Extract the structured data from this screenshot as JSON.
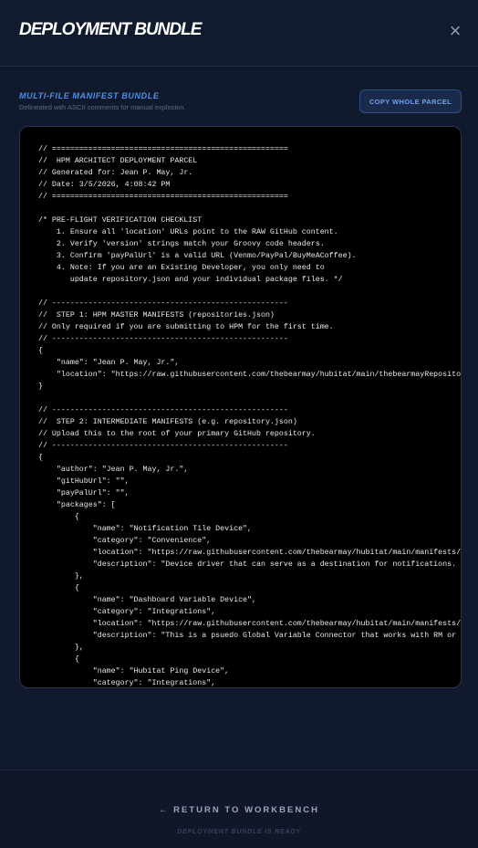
{
  "header": {
    "title": "DEPLOYMENT BUNDLE",
    "close_icon": "×"
  },
  "section": {
    "label": "MULTI-FILE MANIFEST BUNDLE",
    "subtitle": "Delineated with ASCII comments for manual explosion.",
    "copy_button": "COPY WHOLE PARCEL"
  },
  "code": {
    "text": "// ====================================================\n//  HPM ARCHITECT DEPLOYMENT PARCEL\n// Generated for: Jean P. May, Jr.\n// Date: 3/5/2026, 4:08:42 PM\n// ====================================================\n\n/* PRE-FLIGHT VERIFICATION CHECKLIST\n    1. Ensure all 'location' URLs point to the RAW GitHub content.\n    2. Verify 'version' strings match your Groovy code headers.\n    3. Confirm 'payPalUrl' is a valid URL (Venmo/PayPal/BuyMeACoffee).\n    4. Note: If you are an Existing Developer, you only need to\n       update repository.json and your individual package files. */\n\n// ----------------------------------------------------\n//  STEP 1: HPM MASTER MANIFESTS (repositories.json)\n// Only required if you are submitting to HPM for the first time.\n// ----------------------------------------------------\n{\n    \"name\": \"Jean P. May, Jr.\",\n    \"location\": \"https://raw.githubusercontent.com/thebearmay/hubitat/main/thebearmayRepository.json\"\n}\n\n// ----------------------------------------------------\n//  STEP 2: INTERMEDIATE MANIFESTS (e.g. repository.json)\n// Upload this to the root of your primary GitHub repository.\n// ----------------------------------------------------\n{\n    \"author\": \"Jean P. May, Jr.\",\n    \"gitHubUrl\": \"\",\n    \"payPalUrl\": \"\",\n    \"packages\": [\n        {\n            \"name\": \"Notification Tile Device\",\n            \"category\": \"Convenience\",\n            \"location\": \"https://raw.githubusercontent.com/thebearmay/hubitat/main/manifests/notificationTile.json\",\n            \"description\": \"Device driver that can serve as a destination for notifications. Formats them for a dashboard tile\"\n        },\n        {\n            \"name\": \"Dashboard Variable Device\",\n            \"category\": \"Integrations\",\n            \"location\": \"https://raw.githubusercontent.com/thebearmay/hubitat/main/manifests/dashVariable.json\",\n            \"description\": \"This is a psuedo Global Variable Connector that works with RM or webCoRE\"\n        },\n        {\n            \"name\": \"Hubitat Ping Device\",\n            \"category\": \"Integrations\","
  },
  "footer": {
    "return_label": "← RETURN TO WORKBENCH",
    "status": "DEPLOYMENT BUNDLE IS READY"
  },
  "colors": {
    "background": "#111a2c",
    "accent": "#4f8fe8",
    "code_background": "#000000"
  },
  "icons": {
    "close": "close-icon",
    "back": "arrow-left-icon"
  }
}
